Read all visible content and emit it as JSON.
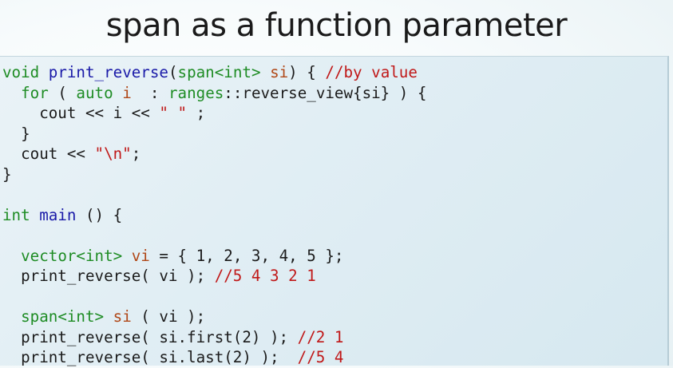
{
  "slide": {
    "title": "span as a function parameter"
  },
  "code": {
    "lines": [
      [
        {
          "t": "void",
          "c": "kw"
        },
        {
          "t": " ",
          "c": ""
        },
        {
          "t": "print_reverse",
          "c": "fn"
        },
        {
          "t": "(",
          "c": ""
        },
        {
          "t": "span<int>",
          "c": "ty"
        },
        {
          "t": " ",
          "c": ""
        },
        {
          "t": "si",
          "c": "var"
        },
        {
          "t": ") { ",
          "c": ""
        },
        {
          "t": "//by value",
          "c": "cm"
        }
      ],
      [
        {
          "t": "  ",
          "c": ""
        },
        {
          "t": "for",
          "c": "kw"
        },
        {
          "t": " ( ",
          "c": ""
        },
        {
          "t": "auto",
          "c": "kw"
        },
        {
          "t": " ",
          "c": ""
        },
        {
          "t": "i",
          "c": "var"
        },
        {
          "t": "  : ",
          "c": ""
        },
        {
          "t": "ranges",
          "c": "ty"
        },
        {
          "t": "::reverse_view{si} ) {",
          "c": ""
        }
      ],
      [
        {
          "t": "    cout << i << ",
          "c": ""
        },
        {
          "t": "\" \"",
          "c": "st"
        },
        {
          "t": " ;",
          "c": ""
        }
      ],
      [
        {
          "t": "  }",
          "c": ""
        }
      ],
      [
        {
          "t": "  cout << ",
          "c": ""
        },
        {
          "t": "\"\\n\"",
          "c": "st"
        },
        {
          "t": ";",
          "c": ""
        }
      ],
      [
        {
          "t": "}",
          "c": ""
        }
      ],
      [],
      [
        {
          "t": "int",
          "c": "kw"
        },
        {
          "t": " ",
          "c": ""
        },
        {
          "t": "main",
          "c": "fn"
        },
        {
          "t": " () {",
          "c": ""
        }
      ],
      [],
      [
        {
          "t": "  ",
          "c": ""
        },
        {
          "t": "vector<int>",
          "c": "ty"
        },
        {
          "t": " ",
          "c": ""
        },
        {
          "t": "vi",
          "c": "var"
        },
        {
          "t": " = { 1, 2, 3, 4, 5 };",
          "c": ""
        }
      ],
      [
        {
          "t": "  print_reverse( vi ); ",
          "c": ""
        },
        {
          "t": "//5 4 3 2 1",
          "c": "cm"
        }
      ],
      [],
      [
        {
          "t": "  ",
          "c": ""
        },
        {
          "t": "span<int>",
          "c": "ty"
        },
        {
          "t": " ",
          "c": ""
        },
        {
          "t": "si",
          "c": "var"
        },
        {
          "t": " ( vi );",
          "c": ""
        }
      ],
      [
        {
          "t": "  print_reverse( si.first(2) ); ",
          "c": ""
        },
        {
          "t": "//2 1",
          "c": "cm"
        }
      ],
      [
        {
          "t": "  print_reverse( si.last(2) );  ",
          "c": ""
        },
        {
          "t": "//5 4",
          "c": "cm"
        }
      ]
    ]
  }
}
